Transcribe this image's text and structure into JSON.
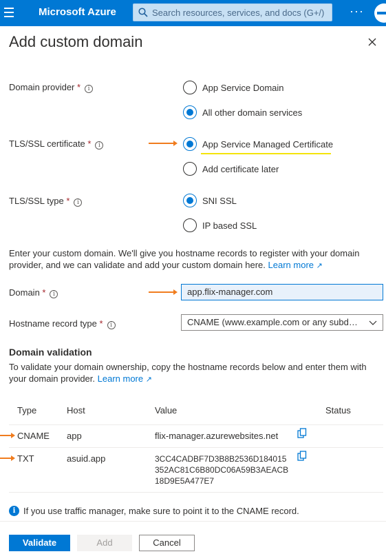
{
  "topbar": {
    "brand": "Microsoft Azure",
    "search_placeholder": "Search resources, services, and docs (G+/)",
    "more": "···"
  },
  "panel": {
    "title": "Add custom domain"
  },
  "form": {
    "domain_provider": {
      "label": "Domain provider",
      "required_mark": "*",
      "options": [
        "App Service Domain",
        "All other domain services"
      ],
      "selected": "All other domain services"
    },
    "tls_certificate": {
      "label": "TLS/SSL certificate",
      "required_mark": "*",
      "options": [
        "App Service Managed Certificate",
        "Add certificate later"
      ],
      "selected": "App Service Managed Certificate"
    },
    "tls_type": {
      "label": "TLS/SSL type",
      "required_mark": "*",
      "options": [
        "SNI SSL",
        "IP based SSL"
      ],
      "selected": "SNI SSL"
    },
    "intro_text": "Enter your custom domain. We'll give you hostname records to register with your domain provider, and we can validate and add your custom domain here.",
    "learn_more": "Learn more",
    "domain": {
      "label": "Domain",
      "required_mark": "*",
      "value": "app.flix-manager.com"
    },
    "hostname_record_type": {
      "label": "Hostname record type",
      "required_mark": "*",
      "value": "CNAME (www.example.com or any subdo..."
    }
  },
  "validation": {
    "heading": "Domain validation",
    "text": "To validate your domain ownership, copy the hostname records below and enter them with your domain provider.",
    "learn_more": "Learn more",
    "columns": [
      "Type",
      "Host",
      "Value",
      "Status"
    ],
    "rows": [
      {
        "type": "CNAME",
        "host": "app",
        "value": "flix-manager.azurewebsites.net",
        "status": ""
      },
      {
        "type": "TXT",
        "host": "asuid.app",
        "value": "3CC4CADBF7D3B8B2536D184015352AC81C6B80DC06A59B3AEACB18D9E5A477E7",
        "status": ""
      }
    ],
    "note": "If you use traffic manager, make sure to point it to the CNAME record."
  },
  "footer": {
    "validate": "Validate",
    "add": "Add",
    "cancel": "Cancel"
  },
  "colors": {
    "accent": "#0078d4",
    "annotation_arrow": "#f07c1e",
    "annotation_highlight": "#f4e40a"
  }
}
